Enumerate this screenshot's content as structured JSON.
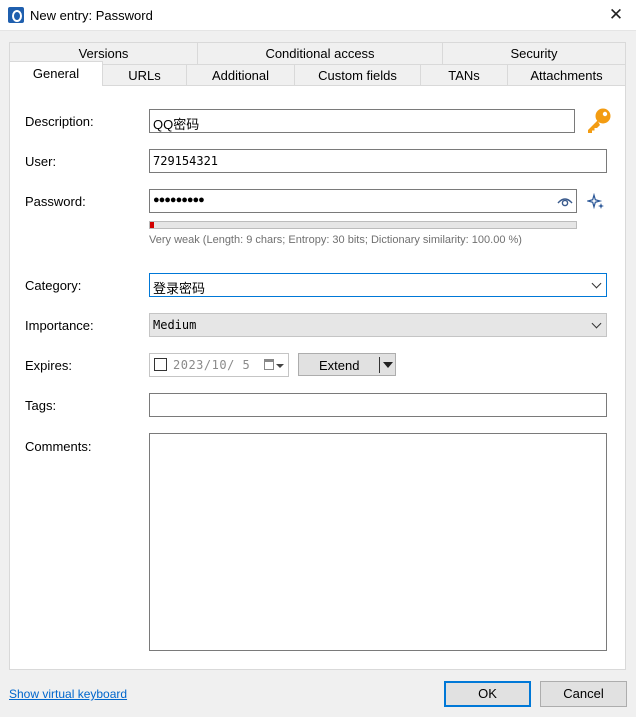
{
  "window": {
    "title": "New entry: Password",
    "close_glyph": "✕"
  },
  "tabs_back": [
    "Versions",
    "Conditional access",
    "Security"
  ],
  "tabs_front": [
    "General",
    "URLs",
    "Additional",
    "Custom fields",
    "TANs",
    "Attachments"
  ],
  "form": {
    "description_label": "Description:",
    "description_value": "QQ密码",
    "user_label": "User:",
    "user_value": "729154321",
    "password_label": "Password:",
    "password_value": "●●●●●●●●●",
    "password_strength_fraction": 0.01,
    "strength_text": "Very weak (Length: 9 chars; Entropy: 30 bits; Dictionary similarity: 100.00 %)",
    "category_label": "Category:",
    "category_value": "登录密码",
    "importance_label": "Importance:",
    "importance_value": "Medium",
    "expires_label": "Expires:",
    "expires_date": "2023/10/ 5",
    "expires_checked": false,
    "extend_label": "Extend",
    "tags_label": "Tags:",
    "tags_value": "",
    "comments_label": "Comments:"
  },
  "footer": {
    "virtual_keyboard_link": "Show virtual keyboard",
    "ok_label": "OK",
    "cancel_label": "Cancel"
  },
  "icons": {
    "app": "app-icon",
    "key": "key-icon",
    "eye": "eye-icon",
    "generate": "sparkle-icon",
    "calendar": "calendar-icon"
  },
  "colors": {
    "accent": "#0078d7",
    "key": "#f39c12",
    "strength_bar": "#d20000",
    "link": "#0066cc"
  }
}
